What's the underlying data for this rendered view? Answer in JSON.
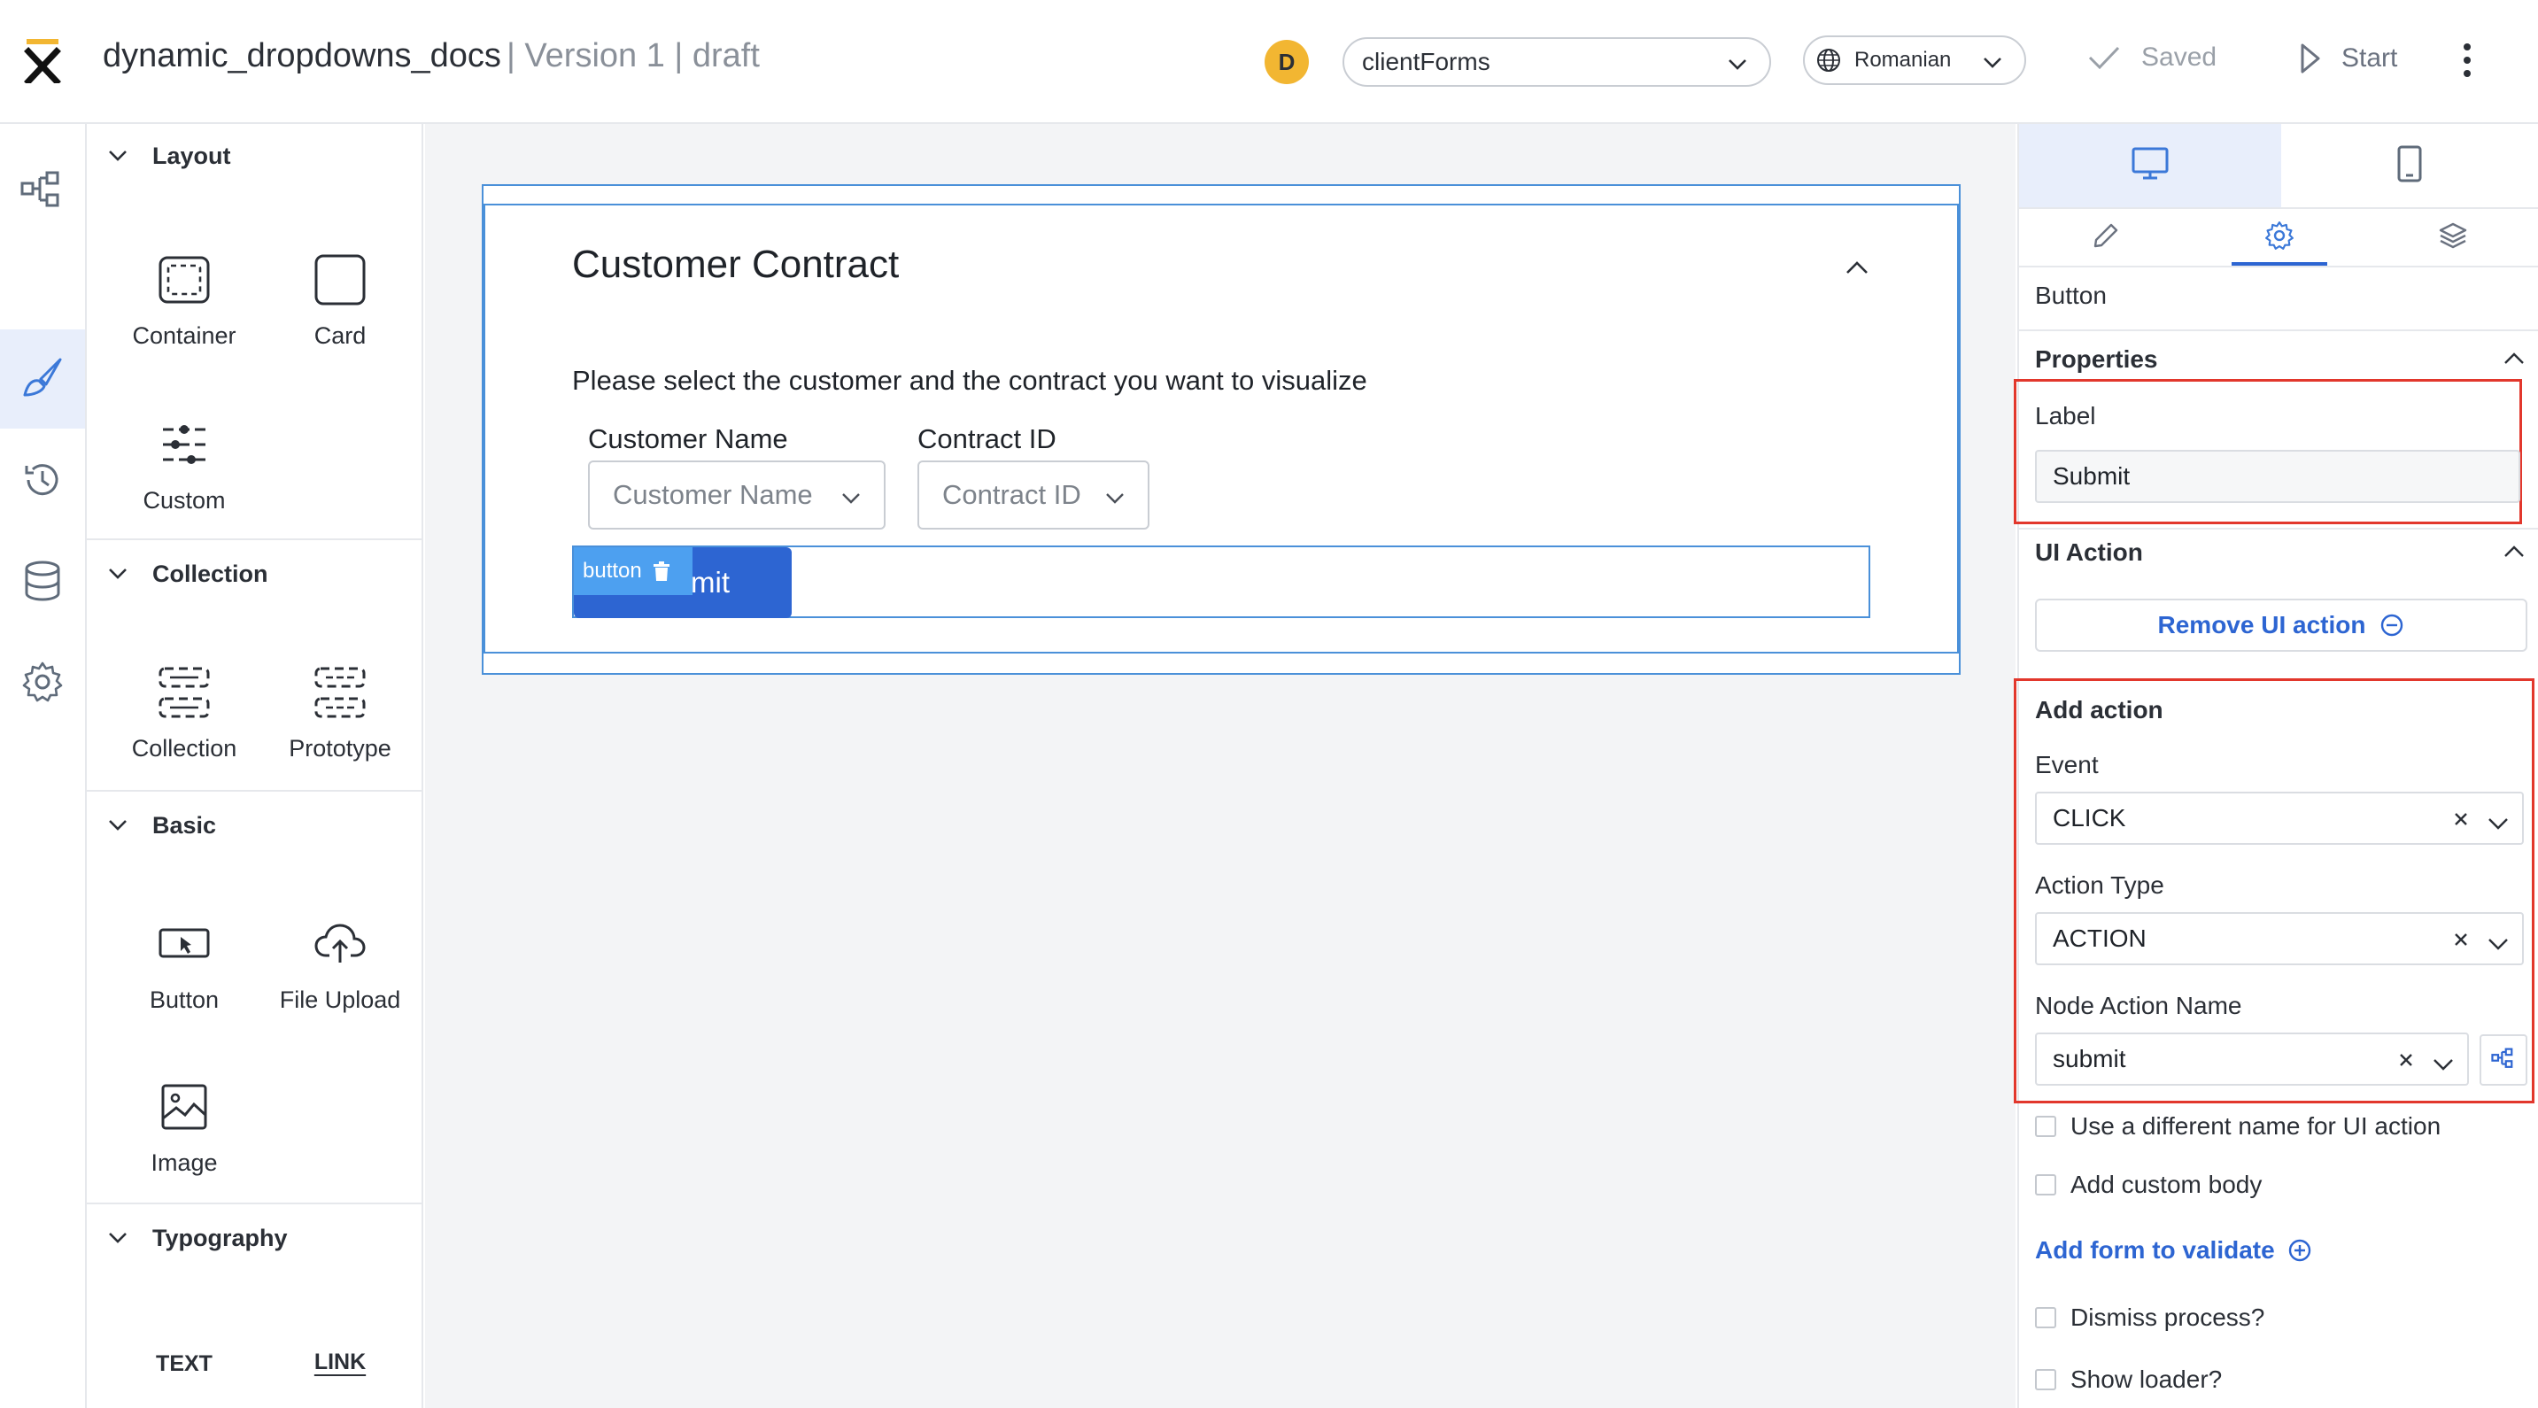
{
  "header": {
    "app_name": "dynamic_dropdowns_docs",
    "version_info": "| Version 1  |  draft",
    "avatar_initial": "D",
    "forms_select_value": "clientForms",
    "language_value": "Romanian",
    "saved_label": "Saved",
    "start_label": "Start"
  },
  "palette": {
    "sections": {
      "layout": "Layout",
      "collection": "Collection",
      "basic": "Basic",
      "typography": "Typography"
    },
    "items": {
      "container": "Container",
      "card": "Card",
      "custom": "Custom",
      "collection": "Collection",
      "prototype": "Prototype",
      "button": "Button",
      "file_upload": "File Upload",
      "image": "Image",
      "text": "TEXT",
      "link": "LINK"
    }
  },
  "canvas": {
    "card_title": "Customer Contract",
    "description": "Please select the customer and the contract you want to visualize",
    "customer_label": "Customer Name",
    "customer_placeholder": "Customer Name",
    "contract_label": "Contract ID",
    "contract_placeholder": "Contract ID",
    "submit_visible_text": "mit",
    "component_tag": "button"
  },
  "right_panel": {
    "component_type": "Button",
    "properties_heading": "Properties",
    "label_field_label": "Label",
    "label_field_value": "Submit",
    "ui_action_heading": "UI Action",
    "remove_ui_action": "Remove UI action",
    "add_action_heading": "Add action",
    "event_label": "Event",
    "event_value": "CLICK",
    "action_type_label": "Action Type",
    "action_type_value": "ACTION",
    "node_action_label": "Node Action Name",
    "node_action_value": "submit",
    "different_name_label": "Use a different name for UI action",
    "custom_body_label": "Add custom body",
    "add_form_validate": "Add form to validate",
    "dismiss_process_label": "Dismiss process?",
    "show_loader_label": "Show loader?"
  },
  "colors": {
    "accent_blue": "#2d65d2",
    "selection_blue": "#4a90d9",
    "highlight_red": "#e2372c",
    "avatar_yellow": "#f2b632"
  }
}
